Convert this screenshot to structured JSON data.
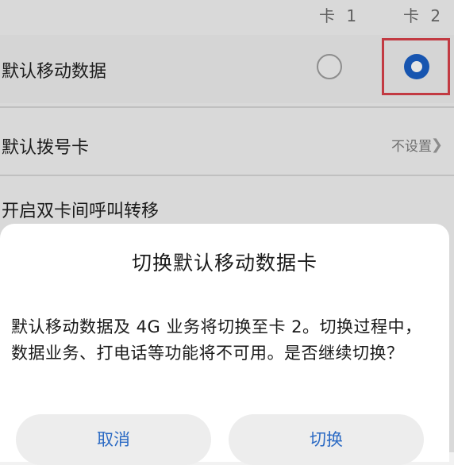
{
  "settings": {
    "card1_header": "卡 1",
    "card2_header": "卡 2",
    "default_data": {
      "label": "默认移动数据",
      "selected_card": 2
    },
    "default_dial": {
      "label": "默认拨号卡",
      "value": "不设置"
    },
    "call_transfer": {
      "label": "开启双卡间呼叫转移"
    }
  },
  "dialog": {
    "title": "切换默认移动数据卡",
    "message": "默认移动数据及 4G 业务将切换至卡 2。切换过程中，数据业务、打电话等功能将不可用。是否继续切换？",
    "cancel_label": "取消",
    "confirm_label": "切换"
  },
  "icons": {
    "chevron": "chevron-right-icon"
  },
  "colors": {
    "accent_blue": "#1a5fc4",
    "button_text": "#2b6ac4",
    "highlight_red": "#d8414a"
  }
}
